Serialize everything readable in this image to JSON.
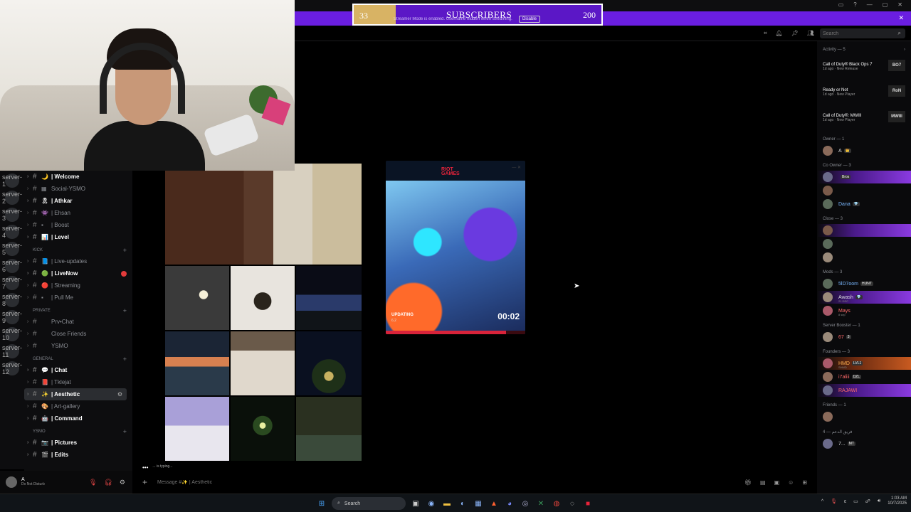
{
  "streamer_banner": {
    "notice": "Streamer Mode is enabled. Username hidden when streaming.",
    "disable_label": "Disable"
  },
  "subscriber_goal": {
    "current": "33",
    "title": "SUBSCRIBERS",
    "target": "200",
    "colors": {
      "left": "#d8b364",
      "main": "#5b17c6"
    }
  },
  "header": {
    "search_placeholder": "Search"
  },
  "server_rail": {
    "icons": [
      "server-1",
      "server-2",
      "server-3",
      "server-4",
      "server-5",
      "server-6",
      "server-7",
      "server-8",
      "server-9",
      "server-10",
      "server-11",
      "server-12"
    ]
  },
  "channels": {
    "top": [
      {
        "emoji": "🌙",
        "label": "| Welcome",
        "bright": true
      },
      {
        "emoji": "▦",
        "label": "Social-YSMO",
        "bright": false
      },
      {
        "emoji": "🎗",
        "label": "| Athkar",
        "bright": true
      },
      {
        "emoji": "👾",
        "label": "| Ehsan",
        "bright": false
      },
      {
        "emoji": "▪",
        "label": "| Boost",
        "bright": false
      },
      {
        "emoji": "📊",
        "label": "| Level",
        "bright": true
      }
    ],
    "cat_kick": "KICK",
    "kick": [
      {
        "emoji": "📘",
        "label": "| Live-updates",
        "bright": false
      },
      {
        "emoji": "🟢",
        "label": "| LiveNow",
        "bright": true,
        "badge": true
      },
      {
        "emoji": "🔴",
        "label": "| Streaming",
        "bright": false
      },
      {
        "emoji": "▪",
        "label": "| Pull Me",
        "bright": false
      }
    ],
    "cat_private": "PRIVATE",
    "private": [
      {
        "emoji": "",
        "label": "Prv•Chat",
        "bright": false
      },
      {
        "emoji": "",
        "label": "Close Friends",
        "bright": false
      },
      {
        "emoji": "",
        "label": "YSMO",
        "bright": false
      }
    ],
    "cat_general": "GENERAL",
    "general": [
      {
        "emoji": "💬",
        "label": "| Chat",
        "bright": true
      },
      {
        "emoji": "📕",
        "label": "| Tklejat",
        "bright": false
      },
      {
        "emoji": "✨",
        "label": "| Aesthetic",
        "bright": true,
        "active": true
      },
      {
        "emoji": "🎨",
        "label": "| Art-gallery",
        "bright": false
      },
      {
        "emoji": "🤖",
        "label": "| Command",
        "bright": true
      }
    ],
    "cat_ysmo": "YSMO",
    "ysmo": [
      {
        "emoji": "📷",
        "label": "| Pictures",
        "bright": true
      },
      {
        "emoji": "🎬",
        "label": "| Edits",
        "bright": true
      }
    ]
  },
  "user_panel": {
    "name": "A",
    "status": "Do Not Disturb"
  },
  "riot": {
    "logo_line1": "RIOT",
    "logo_line2": "GAMES",
    "status": "UPDATING",
    "version": "6.2",
    "timer": "00:02",
    "progress": 0.86
  },
  "typing": {
    "text": "... is typing..."
  },
  "composer": {
    "placeholder": "Message #✨ | Aesthetic"
  },
  "members": {
    "activity_header": "Activity — 5",
    "activities": [
      {
        "title": "Call of Duty® Black Ops 7",
        "sub": "1d ago · New Release",
        "icon": "BO7"
      },
      {
        "title": "Ready or Not",
        "sub": "1d ago · New Player",
        "icon": "RoN"
      },
      {
        "title": "Call of Duty®: MWIII",
        "sub": "1d ago · New Player",
        "icon": "MWIII"
      }
    ],
    "sections": [
      {
        "header": "Owner — 1",
        "members": [
          {
            "name": "A",
            "tag": "👑",
            "style": ""
          }
        ]
      },
      {
        "header": "Co Owner — 3",
        "members": [
          {
            "name": "",
            "tag": "Bros",
            "style": "grad"
          },
          {
            "name": "",
            "tag": "",
            "style": ""
          },
          {
            "name": "Dana",
            "tag": "💎",
            "style": ""
          }
        ]
      },
      {
        "header": "Close — 3",
        "members": [
          {
            "name": "",
            "tag": "",
            "style": "grad"
          },
          {
            "name": "",
            "tag": "",
            "style": ""
          },
          {
            "name": "",
            "tag": "",
            "style": ""
          }
        ]
      },
      {
        "header": "Mods — 3",
        "members": [
          {
            "name": "5lD7oom",
            "tag": "HUNT",
            "sub": "",
            "style": ""
          },
          {
            "name": "Awash",
            "tag": "💎",
            "sub": "21 DEC",
            "style": "grad"
          },
          {
            "name": "Mays",
            "tag": "",
            "sub": "8 sep",
            "style": ""
          }
        ]
      },
      {
        "header": "Server Booster — 1",
        "members": [
          {
            "name": "67",
            "tag": "3",
            "style": ""
          }
        ]
      },
      {
        "header": "Founders — 3",
        "members": [
          {
            "name": "HMD",
            "tag": "LVL1",
            "sub": "SHMD",
            "style": "grad2"
          },
          {
            "name": "i7aliii",
            "tag": "DZL",
            "style": ""
          },
          {
            "name": "RAJAWI",
            "tag": "",
            "style": "grad"
          }
        ]
      },
      {
        "header": "Friends — 1",
        "members": [
          {
            "name": "",
            "tag": "",
            "style": ""
          }
        ]
      },
      {
        "header": "4 — فريق الدعم",
        "members": [
          {
            "name": "7...",
            "tag": "MT",
            "style": ""
          }
        ]
      }
    ]
  },
  "taskbar": {
    "search_label": "Search",
    "time": "1:03 AM",
    "date": "10/7/2025"
  }
}
